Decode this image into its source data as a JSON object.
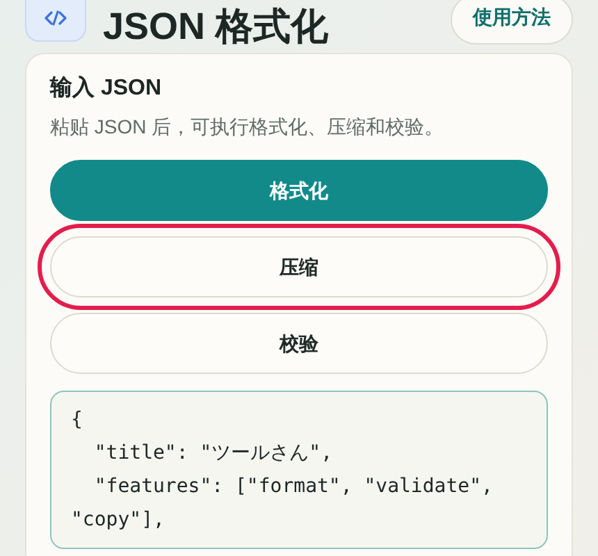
{
  "header": {
    "title": "JSON 格式化",
    "help_button": "使用方法"
  },
  "panel": {
    "title": "输入 JSON",
    "description": "粘贴 JSON 后，可执行格式化、压缩和校验。"
  },
  "actions": [
    {
      "label": "格式化",
      "kind": "primary",
      "focused": false
    },
    {
      "label": "压缩",
      "kind": "secondary",
      "focused": true
    },
    {
      "label": "校验",
      "kind": "secondary",
      "focused": false
    }
  ],
  "editor": {
    "value": "{\n  \"title\": \"ツールさん\",\n  \"features\": [\"format\", \"validate\", \"copy\"],"
  }
}
